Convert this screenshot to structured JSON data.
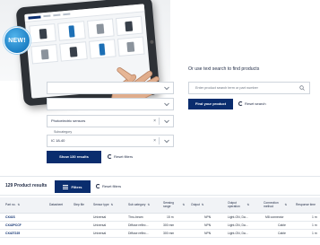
{
  "hero": {
    "badge": "NEW!"
  },
  "filters": {
    "select_a_value": "",
    "select_b_value": "",
    "select_c_value": "Photoelectric sensors",
    "select_d_label": "Subcategory",
    "select_d_value": "IC 18-40",
    "show_button": "Show 130 results",
    "reset_label": "Reset filters"
  },
  "search": {
    "title": "Or use text search to find products",
    "placeholder": "Enter product search term or part number",
    "find_button": "Find your product",
    "reset_label": "Reset search"
  },
  "results": {
    "count": "129 Product results",
    "filters_button": "Filters",
    "reset_label": "Reset filters"
  },
  "table": {
    "headers": [
      {
        "label": "Part no.",
        "sort": "⇅"
      },
      {
        "label": "Datasheet",
        "sort": ""
      },
      {
        "label": "Step file",
        "sort": ""
      },
      {
        "label": "Sensor type",
        "sort": "⇅"
      },
      {
        "label": "Sub category",
        "sort": "⇅"
      },
      {
        "label": "Sensing range",
        "sort": "⇅"
      },
      {
        "label": "Output",
        "sort": "⇅"
      },
      {
        "label": "Output operation",
        "sort": "⇅"
      },
      {
        "label": "Connection method",
        "sort": "⇅"
      },
      {
        "label": "Response time",
        "sort": ""
      }
    ],
    "rows": [
      [
        "CX41S",
        "",
        "",
        "Universal",
        "Thru-beam",
        "15 m",
        "NPN",
        "Light-ON, Da...",
        "M8 connector",
        "1 m"
      ],
      [
        "CX42PCCF",
        "",
        "",
        "Universal",
        "Diffuse reflec...",
        "300 mm",
        "NPN",
        "Light-ON, Da...",
        "Cable",
        "1 m"
      ],
      [
        "CX42T225",
        "",
        "",
        "Universal",
        "Diffuse reflec...",
        "300 mm",
        "NPN",
        "Light-ON, Da...",
        "Cable",
        "1 m"
      ]
    ]
  },
  "colors": {
    "navy": "#0a2d6e",
    "badge_blue": "#1c7fc4",
    "border": "#cfd5dc",
    "header_bg": "#f1f3f6"
  }
}
